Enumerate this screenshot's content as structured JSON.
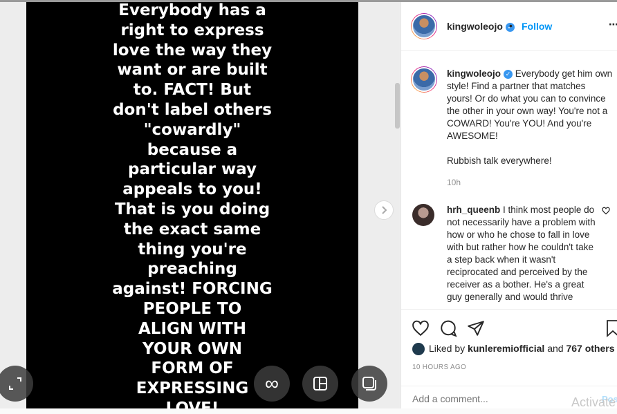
{
  "media": {
    "lines": [
      "Everybody has a",
      "right to express",
      "love the way they",
      "want or are built",
      "to. FACT! But",
      "don't label others",
      "\"cowardly\"",
      "because a",
      "particular way",
      "appeals to you!",
      "That is you doing",
      "the exact same",
      "thing you're",
      "preaching",
      "against! FORCING",
      "PEOPLE TO",
      "ALIGN WITH",
      "YOUR OWN",
      "FORM OF",
      "EXPRESSING",
      "LOVE!"
    ]
  },
  "header": {
    "username": "kingwoleojo",
    "separator": "•",
    "follow_label": "Follow",
    "more": "⋯"
  },
  "caption": {
    "username": "kingwoleojo",
    "text": "Everybody get him own style! Find a partner that matches yours! Or do what you can to convince the other in your own way! You're not a COWARD! You're YOU! And you're AWESOME!",
    "text2": "Rubbish talk everywhere!",
    "time": "10h"
  },
  "comment": {
    "username": "hrh_queenb",
    "text": "I think most people do not necessarily have a problem with how or who he chose to fall in love with but rather how he couldn't take a step back when it wasn't reciprocated and perceived by the receiver as a bother. He's a great guy generally and would thrive"
  },
  "likes": {
    "prefix": "Liked by ",
    "user": "kunleremiofficial",
    "and": " and ",
    "others": "767 others"
  },
  "posted_ago": "10 HOURS AGO",
  "add_comment": {
    "placeholder": "Add a comment...",
    "post_label": "Post"
  },
  "watermark": "Activate",
  "colors": {
    "link": "#0095f6",
    "verified": "#3897f0",
    "muted": "#8e8e8e"
  }
}
